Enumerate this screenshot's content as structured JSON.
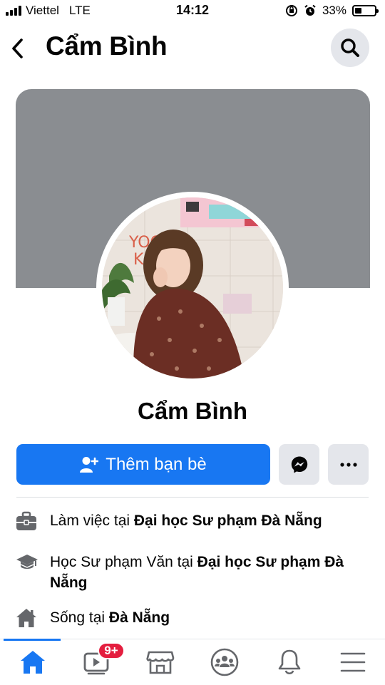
{
  "status_bar": {
    "carrier": "Viettel",
    "network": "LTE",
    "time": "14:12",
    "battery_percent": "33%",
    "battery_level": 0.33
  },
  "header": {
    "title": "Cẩm Bình",
    "back_icon": "chevron-left-icon",
    "search_icon": "search-icon"
  },
  "profile": {
    "name": "Cẩm Bình",
    "avatar_icon": "profile-photo"
  },
  "actions": {
    "add_friend_label": "Thêm bạn bè",
    "messenger_icon": "messenger-icon",
    "more_icon": "more-dots-icon"
  },
  "intro": [
    {
      "icon": "briefcase-icon",
      "prefix": "Làm việc tại ",
      "bold": "Đại học Sư phạm Đà Nẵng"
    },
    {
      "icon": "graduation-cap-icon",
      "prefix": "Học Sư phạm Văn tại ",
      "bold": "Đại học Sư phạm Đà Nẵng"
    },
    {
      "icon": "house-icon",
      "prefix": "Sống tại ",
      "bold": "Đà Nẵng"
    }
  ],
  "tabs": [
    {
      "name": "home",
      "icon": "home-icon",
      "active": true
    },
    {
      "name": "watch",
      "icon": "video-icon",
      "badge": "9+"
    },
    {
      "name": "marketplace",
      "icon": "marketplace-icon"
    },
    {
      "name": "groups",
      "icon": "groups-icon"
    },
    {
      "name": "notifications",
      "icon": "bell-icon"
    },
    {
      "name": "menu",
      "icon": "menu-icon"
    }
  ],
  "colors": {
    "accent": "#1877f2",
    "badge": "#e41e3f",
    "cover": "#8a8d91",
    "button_gray": "#e4e6eb"
  }
}
